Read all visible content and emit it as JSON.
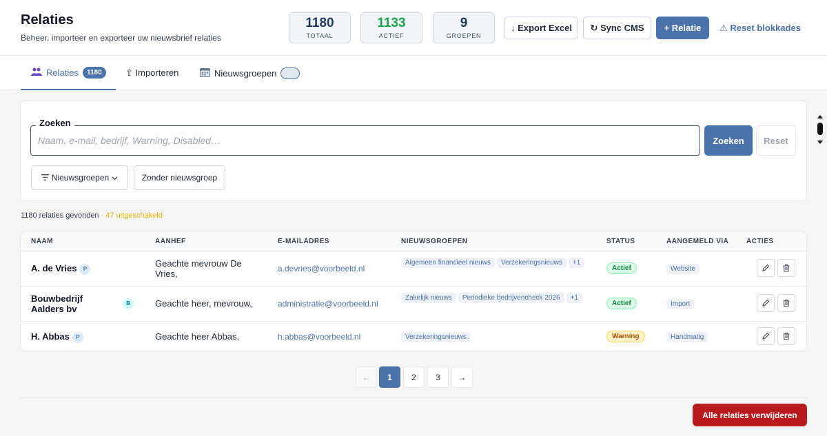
{
  "header": {
    "title": "Relaties",
    "subtitle": "Beheer, importeer en exporteer uw nieuwsbrief relaties",
    "stats": [
      {
        "value": "1180",
        "label": "TOTAAL"
      },
      {
        "value": "1133",
        "label": "ACTIEF"
      },
      {
        "value": "9",
        "label": "GROEPEN"
      }
    ],
    "export_label": "↓ Export Excel",
    "sync_label": "↻ Sync CMS",
    "new_label": "+ Relatie",
    "reset_blocks_label": "⚠ Reset blokkades"
  },
  "tabs": {
    "relaties": {
      "label": "Relaties",
      "count": "1180",
      "icon": "people-icon"
    },
    "import": {
      "label": "⇧ Importeren"
    },
    "groups": {
      "label": "Nieuwsgroepen",
      "icon": "calendar-icon"
    }
  },
  "search": {
    "legend": "Zoeken",
    "placeholder": "Naam, e-mail, bedrijf, Warning, Disabled…",
    "search_label": "Zoeken",
    "reset_label": "Reset",
    "filter_label": "Nieuwsgroepen",
    "nogroup_label": "Zonder nieuwsgroep"
  },
  "results": {
    "found": "1180 relaties gevonden",
    "disabled": "· 47 uitgeschakeld"
  },
  "table": {
    "headers": [
      "NAAM",
      "AANHEF",
      "E-MAILADRES",
      "NIEUWSGROEPEN",
      "STATUS",
      "AANGEMELD VIA",
      "ACTIES"
    ],
    "rows": [
      {
        "name": "A. de Vries",
        "type": "P",
        "salutation": "Geachte mevrouw De Vries,",
        "email": "a.devries@voorbeeld.nl",
        "groups": [
          "Algemeen financieel nieuws",
          "Verzekeringsnieuws"
        ],
        "more": "+1",
        "status": "Actief",
        "via": "Website"
      },
      {
        "name": "Bouwbedrijf Aalders bv",
        "type": "B",
        "salutation": "Geachte heer, mevrouw,",
        "email": "administratie@voorbeeld.nl",
        "groups": [
          "Zakelijk nieuws",
          "Periodieke bedrijvencheck 2026"
        ],
        "more": "+1",
        "status": "Actief",
        "via": "Import"
      },
      {
        "name": "H. Abbas",
        "type": "P",
        "salutation": "Geachte heer Abbas,",
        "email": "h.abbas@voorbeeld.nl",
        "groups": [
          "Verzekeringsnieuws"
        ],
        "more": "",
        "status": "Warning",
        "via": "Handmatig"
      }
    ]
  },
  "pagination": {
    "prev": "←",
    "pages": [
      "1",
      "2",
      "3"
    ],
    "next": "→"
  },
  "footer": {
    "delete_all_label": "Alle relaties verwijderen"
  },
  "colors": {
    "accent": "#4a72ab",
    "success": "#16a34a",
    "warning": "#eab308",
    "danger": "#b91c1c"
  }
}
